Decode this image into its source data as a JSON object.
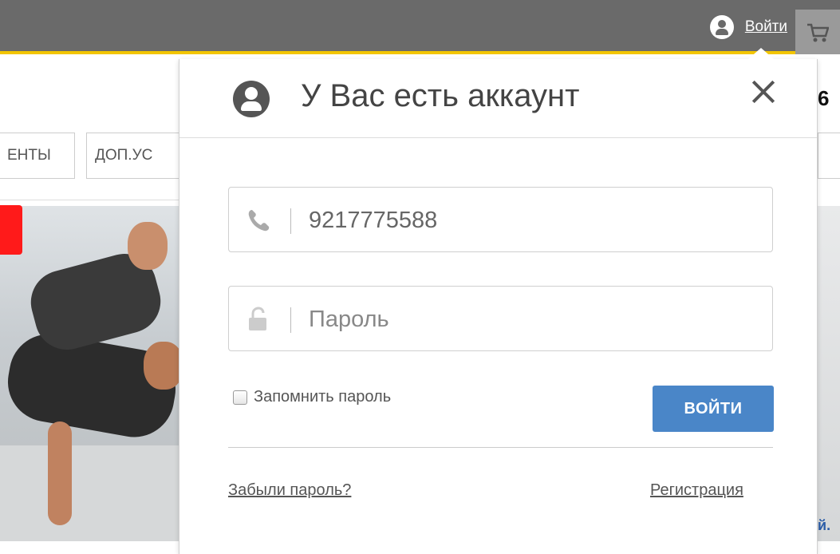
{
  "topbar": {
    "login_label": "Войти",
    "accent_color": "#f2c500"
  },
  "background": {
    "nav_tabs": [
      "ЕНТЫ",
      "ДОП.УС"
    ],
    "right_fragment": "6",
    "right_bottom_fragment": "й."
  },
  "popup": {
    "title": "У Вас есть аккаунт",
    "phone": {
      "value": "9217775588",
      "icon": "phone-icon"
    },
    "password": {
      "placeholder": "Пароль",
      "icon": "lock-icon"
    },
    "remember_label": "Запомнить пароль",
    "submit_label": "ВОЙТИ",
    "forgot_label": "Забыли пароль?",
    "register_label": "Регистрация",
    "button_color": "#4a86c8"
  }
}
